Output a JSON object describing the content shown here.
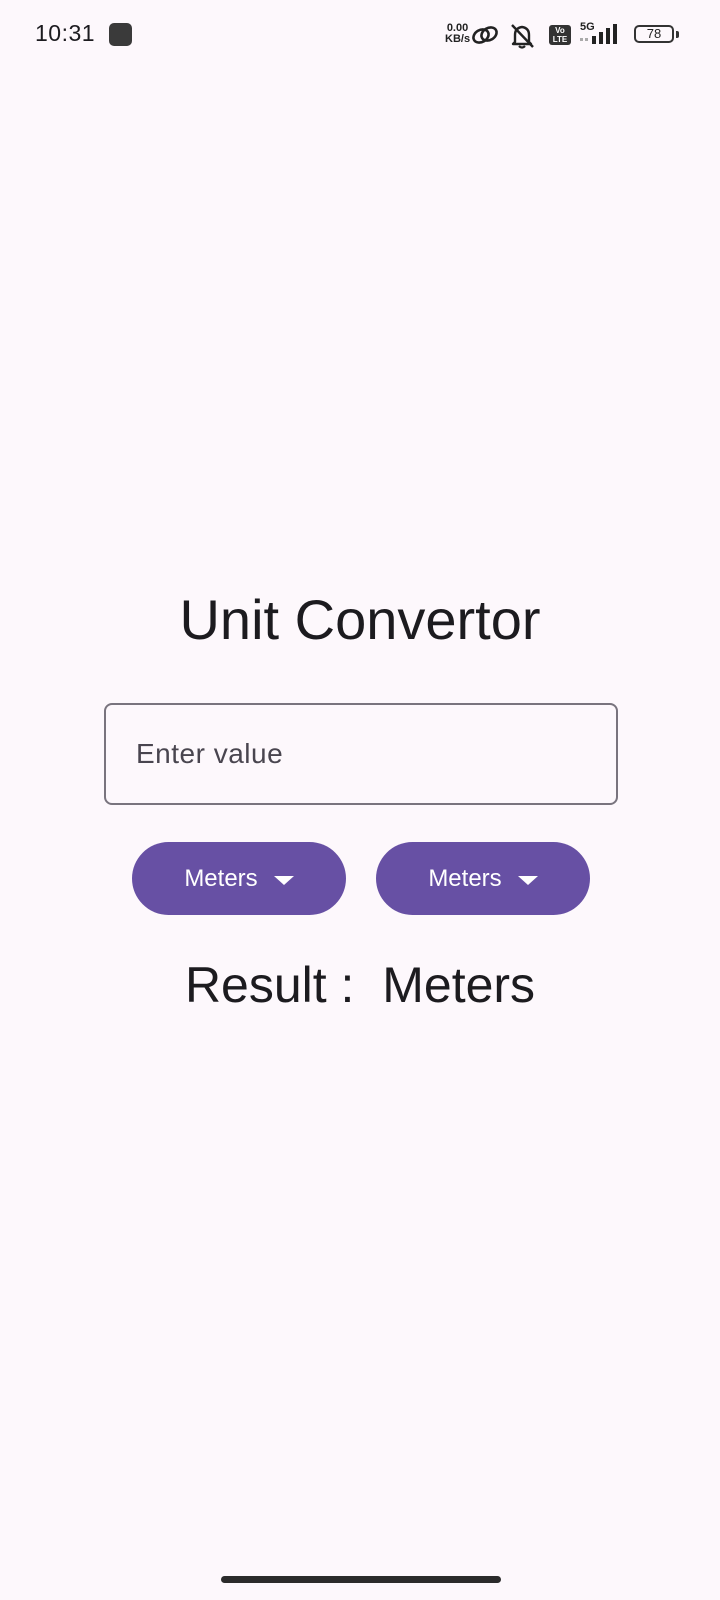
{
  "status_bar": {
    "time": "10:31",
    "net_speed_value": "0.00",
    "net_speed_unit": "KB/s",
    "volte_top": "Vo",
    "volte_bottom": "LTE",
    "network_type": "5G",
    "battery_level": "78",
    "icons": [
      "app-notification-icon",
      "link-icon",
      "bell-off-icon",
      "volte-icon",
      "signal-icon",
      "battery-icon"
    ]
  },
  "app": {
    "title": "Unit Convertor",
    "input": {
      "placeholder": "Enter value",
      "value": ""
    },
    "from_unit_button": {
      "label": "Meters",
      "icon": "arrow-drop-down-icon"
    },
    "to_unit_button": {
      "label": "Meters",
      "icon": "arrow-drop-down-icon"
    },
    "result": {
      "label": "Result :",
      "value": "",
      "unit": "Meters"
    }
  },
  "colors": {
    "background": "#fdf8fc",
    "primary": "#6750a4",
    "outline": "#79747e",
    "text": "#1c1b1f"
  }
}
